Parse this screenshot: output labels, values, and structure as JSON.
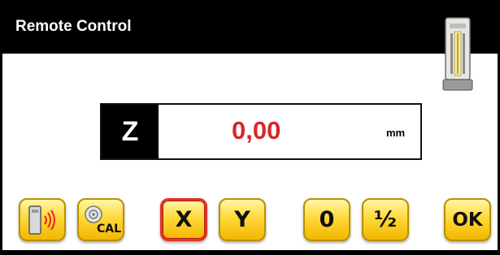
{
  "window": {
    "title": "Remote Control"
  },
  "readout": {
    "axis": "Z",
    "value": "0,00",
    "unit": "mm"
  },
  "toolbar": {
    "wireless_icon": "wireless-transmitter-icon",
    "cal_label": "CAL",
    "x_label": "X",
    "y_label": "Y",
    "zero_label": "0",
    "half_label": "½",
    "ok_label": "OK"
  },
  "colors": {
    "value_red": "#d8252a",
    "button_yellow": "#ffd93a",
    "selected_border": "#e2322a"
  }
}
